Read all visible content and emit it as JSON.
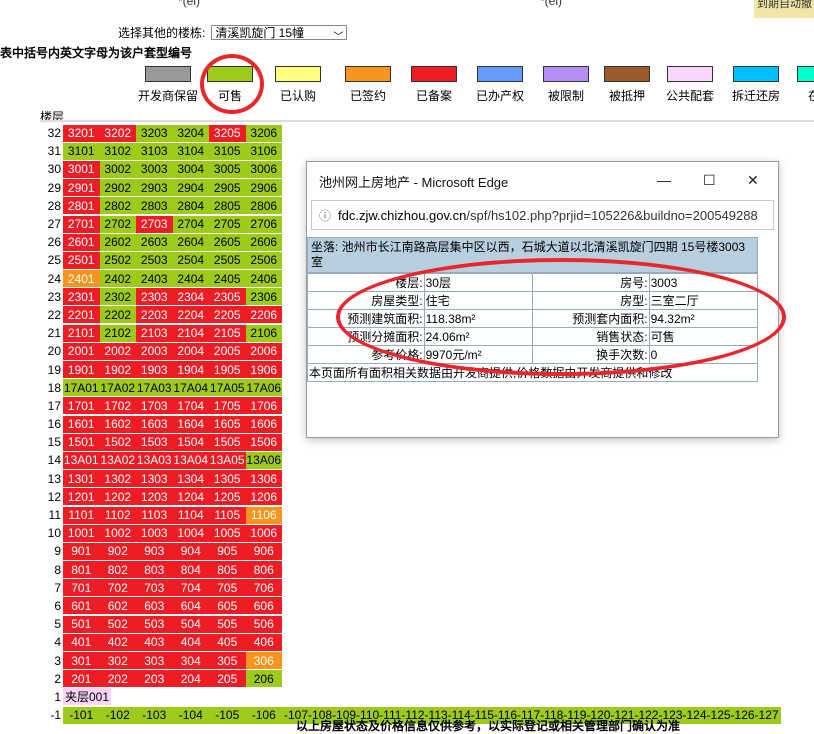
{
  "top": {
    "frag1": "*(el)",
    "frag2": "*(el)",
    "note": "到期自动撤"
  },
  "select_row": {
    "label": "选择其他的楼栋:",
    "value": "清溪凯旋门 15幢"
  },
  "hint": "表中括号内英文字母为该户套型编号",
  "legend": [
    {
      "label": "开发商保留",
      "color": "#999999"
    },
    {
      "label": "可售",
      "color": "#9dcb1c"
    },
    {
      "label": "已认购",
      "color": "#ffff80"
    },
    {
      "label": "已签约",
      "color": "#f7941d"
    },
    {
      "label": "已备案",
      "color": "#ee1c25"
    },
    {
      "label": "已办产权",
      "color": "#6699ff"
    },
    {
      "label": "被限制",
      "color": "#b38ef5"
    },
    {
      "label": "被抵押",
      "color": "#9c5b2b"
    },
    {
      "label": "公共配套",
      "color": "#f9d4f9"
    },
    {
      "label": "拆迁还房",
      "color": "#00bfff"
    },
    {
      "label": "在办",
      "color": "#00ffcc"
    }
  ],
  "floor_header": "楼层",
  "floors": [
    {
      "n": "32",
      "units": [
        [
          "3201",
          "s"
        ],
        [
          "3202",
          "s"
        ],
        [
          "3203",
          "a"
        ],
        [
          "3204",
          "a"
        ],
        [
          "3205",
          "s"
        ],
        [
          "3206",
          "a"
        ]
      ]
    },
    {
      "n": "31",
      "units": [
        [
          "3101",
          "a"
        ],
        [
          "3102",
          "a"
        ],
        [
          "3103",
          "a"
        ],
        [
          "3104",
          "a"
        ],
        [
          "3105",
          "a"
        ],
        [
          "3106",
          "a"
        ]
      ]
    },
    {
      "n": "30",
      "units": [
        [
          "3001",
          "s"
        ],
        [
          "3002",
          "a"
        ],
        [
          "3003",
          "a"
        ],
        [
          "3004",
          "a"
        ],
        [
          "3005",
          "a"
        ],
        [
          "3006",
          "a"
        ]
      ]
    },
    {
      "n": "29",
      "units": [
        [
          "2901",
          "s"
        ],
        [
          "2902",
          "a"
        ],
        [
          "2903",
          "a"
        ],
        [
          "2904",
          "a"
        ],
        [
          "2905",
          "a"
        ],
        [
          "2906",
          "a"
        ]
      ]
    },
    {
      "n": "28",
      "units": [
        [
          "2801",
          "s"
        ],
        [
          "2802",
          "a"
        ],
        [
          "2803",
          "a"
        ],
        [
          "2804",
          "a"
        ],
        [
          "2805",
          "a"
        ],
        [
          "2806",
          "a"
        ]
      ]
    },
    {
      "n": "27",
      "units": [
        [
          "2701",
          "s"
        ],
        [
          "2702",
          "a"
        ],
        [
          "2703",
          "s"
        ],
        [
          "2704",
          "a"
        ],
        [
          "2705",
          "a"
        ],
        [
          "2706",
          "a"
        ]
      ]
    },
    {
      "n": "26",
      "units": [
        [
          "2601",
          "s"
        ],
        [
          "2602",
          "a"
        ],
        [
          "2603",
          "a"
        ],
        [
          "2604",
          "a"
        ],
        [
          "2605",
          "a"
        ],
        [
          "2606",
          "a"
        ]
      ]
    },
    {
      "n": "25",
      "units": [
        [
          "2501",
          "s"
        ],
        [
          "2502",
          "a"
        ],
        [
          "2503",
          "a"
        ],
        [
          "2504",
          "a"
        ],
        [
          "2505",
          "a"
        ],
        [
          "2506",
          "a"
        ]
      ]
    },
    {
      "n": "24",
      "units": [
        [
          "2401",
          "o"
        ],
        [
          "2402",
          "a"
        ],
        [
          "2403",
          "a"
        ],
        [
          "2404",
          "a"
        ],
        [
          "2405",
          "a"
        ],
        [
          "2406",
          "a"
        ]
      ]
    },
    {
      "n": "23",
      "units": [
        [
          "2301",
          "s"
        ],
        [
          "2302",
          "a"
        ],
        [
          "2303",
          "s"
        ],
        [
          "2304",
          "s"
        ],
        [
          "2305",
          "s"
        ],
        [
          "2306",
          "a"
        ]
      ]
    },
    {
      "n": "22",
      "units": [
        [
          "2201",
          "s"
        ],
        [
          "2202",
          "a"
        ],
        [
          "2203",
          "s"
        ],
        [
          "2204",
          "s"
        ],
        [
          "2205",
          "s"
        ],
        [
          "2206",
          "s"
        ]
      ]
    },
    {
      "n": "21",
      "units": [
        [
          "2101",
          "s"
        ],
        [
          "2102",
          "a"
        ],
        [
          "2103",
          "s"
        ],
        [
          "2104",
          "s"
        ],
        [
          "2105",
          "s"
        ],
        [
          "2106",
          "a"
        ]
      ]
    },
    {
      "n": "20",
      "units": [
        [
          "2001",
          "s"
        ],
        [
          "2002",
          "s"
        ],
        [
          "2003",
          "s"
        ],
        [
          "2004",
          "s"
        ],
        [
          "2005",
          "s"
        ],
        [
          "2006",
          "s"
        ]
      ]
    },
    {
      "n": "19",
      "units": [
        [
          "1901",
          "s"
        ],
        [
          "1902",
          "s"
        ],
        [
          "1903",
          "s"
        ],
        [
          "1904",
          "s"
        ],
        [
          "1905",
          "s"
        ],
        [
          "1906",
          "s"
        ]
      ]
    },
    {
      "n": "18",
      "units": [
        [
          "17A01",
          "a"
        ],
        [
          "17A02",
          "a"
        ],
        [
          "17A03",
          "a"
        ],
        [
          "17A04",
          "a"
        ],
        [
          "17A05",
          "a"
        ],
        [
          "17A06",
          "a"
        ]
      ]
    },
    {
      "n": "17",
      "units": [
        [
          "1701",
          "s"
        ],
        [
          "1702",
          "s"
        ],
        [
          "1703",
          "s"
        ],
        [
          "1704",
          "s"
        ],
        [
          "1705",
          "s"
        ],
        [
          "1706",
          "s"
        ]
      ]
    },
    {
      "n": "16",
      "units": [
        [
          "1601",
          "s"
        ],
        [
          "1602",
          "s"
        ],
        [
          "1603",
          "s"
        ],
        [
          "1604",
          "s"
        ],
        [
          "1605",
          "s"
        ],
        [
          "1606",
          "s"
        ]
      ]
    },
    {
      "n": "15",
      "units": [
        [
          "1501",
          "s"
        ],
        [
          "1502",
          "s"
        ],
        [
          "1503",
          "s"
        ],
        [
          "1504",
          "s"
        ],
        [
          "1505",
          "s"
        ],
        [
          "1506",
          "s"
        ]
      ]
    },
    {
      "n": "14",
      "units": [
        [
          "13A01",
          "s"
        ],
        [
          "13A02",
          "s"
        ],
        [
          "13A03",
          "s"
        ],
        [
          "13A04",
          "s"
        ],
        [
          "13A05",
          "s"
        ],
        [
          "13A06",
          "a"
        ]
      ]
    },
    {
      "n": "13",
      "units": [
        [
          "1301",
          "s"
        ],
        [
          "1302",
          "s"
        ],
        [
          "1303",
          "s"
        ],
        [
          "1304",
          "s"
        ],
        [
          "1305",
          "s"
        ],
        [
          "1306",
          "s"
        ]
      ]
    },
    {
      "n": "12",
      "units": [
        [
          "1201",
          "s"
        ],
        [
          "1202",
          "s"
        ],
        [
          "1203",
          "s"
        ],
        [
          "1204",
          "s"
        ],
        [
          "1205",
          "s"
        ],
        [
          "1206",
          "s"
        ]
      ]
    },
    {
      "n": "11",
      "units": [
        [
          "1101",
          "s"
        ],
        [
          "1102",
          "s"
        ],
        [
          "1103",
          "s"
        ],
        [
          "1104",
          "s"
        ],
        [
          "1105",
          "s"
        ],
        [
          "1106",
          "o"
        ]
      ]
    },
    {
      "n": "10",
      "units": [
        [
          "1001",
          "s"
        ],
        [
          "1002",
          "s"
        ],
        [
          "1003",
          "s"
        ],
        [
          "1004",
          "s"
        ],
        [
          "1005",
          "s"
        ],
        [
          "1006",
          "s"
        ]
      ]
    },
    {
      "n": "9",
      "units": [
        [
          "901",
          "s"
        ],
        [
          "902",
          "s"
        ],
        [
          "903",
          "s"
        ],
        [
          "904",
          "s"
        ],
        [
          "905",
          "s"
        ],
        [
          "906",
          "s"
        ]
      ]
    },
    {
      "n": "8",
      "units": [
        [
          "801",
          "s"
        ],
        [
          "802",
          "s"
        ],
        [
          "803",
          "s"
        ],
        [
          "804",
          "s"
        ],
        [
          "805",
          "s"
        ],
        [
          "806",
          "s"
        ]
      ]
    },
    {
      "n": "7",
      "units": [
        [
          "701",
          "s"
        ],
        [
          "702",
          "s"
        ],
        [
          "703",
          "s"
        ],
        [
          "704",
          "s"
        ],
        [
          "705",
          "s"
        ],
        [
          "706",
          "s"
        ]
      ]
    },
    {
      "n": "6",
      "units": [
        [
          "601",
          "s"
        ],
        [
          "602",
          "s"
        ],
        [
          "603",
          "s"
        ],
        [
          "604",
          "s"
        ],
        [
          "605",
          "s"
        ],
        [
          "606",
          "s"
        ]
      ]
    },
    {
      "n": "5",
      "units": [
        [
          "501",
          "s"
        ],
        [
          "502",
          "s"
        ],
        [
          "503",
          "s"
        ],
        [
          "504",
          "s"
        ],
        [
          "505",
          "s"
        ],
        [
          "506",
          "s"
        ]
      ]
    },
    {
      "n": "4",
      "units": [
        [
          "401",
          "s"
        ],
        [
          "402",
          "s"
        ],
        [
          "403",
          "s"
        ],
        [
          "404",
          "s"
        ],
        [
          "405",
          "s"
        ],
        [
          "406",
          "s"
        ]
      ]
    },
    {
      "n": "3",
      "units": [
        [
          "301",
          "s"
        ],
        [
          "302",
          "s"
        ],
        [
          "303",
          "s"
        ],
        [
          "304",
          "s"
        ],
        [
          "305",
          "s"
        ],
        [
          "306",
          "o"
        ]
      ]
    },
    {
      "n": "2",
      "units": [
        [
          "201",
          "s"
        ],
        [
          "202",
          "s"
        ],
        [
          "203",
          "s"
        ],
        [
          "204",
          "s"
        ],
        [
          "205",
          "s"
        ],
        [
          "206",
          "a"
        ]
      ]
    },
    {
      "n": "1",
      "units": [
        [
          "夹层001",
          "p"
        ]
      ]
    },
    {
      "n": "-1",
      "units": [
        [
          "-101",
          "a"
        ],
        [
          "-102",
          "a"
        ],
        [
          "-103",
          "a"
        ],
        [
          "-104",
          "a"
        ],
        [
          "-105",
          "a"
        ],
        [
          "-106",
          "a"
        ],
        [
          "-107-108-109-110-111-112-113-114-115-116-117-118-119-120-121-122-123-124-125-126-127",
          "a"
        ]
      ]
    }
  ],
  "bottom_note": "以上房屋状态及价格信息仅供参考，以实际登记或相关管理部门确认为准",
  "popup": {
    "title": "池州网上房地产 - Microsoft Edge",
    "min": "—",
    "max": "☐",
    "close": "✕",
    "url_domain": "fdc.zjw.chizhou.gov.cn",
    "url_path": "/spf/hs102.php?prjid=105226&buildno=200549288",
    "address": "坐落:   池州市长江南路高层集中区以西，石城大道以北清溪凯旋门四期 15号楼3003室",
    "rows": [
      {
        "k1": "楼层:",
        "v1": "30层",
        "k2": "房号:",
        "v2": "3003"
      },
      {
        "k1": "房屋类型:",
        "v1": "住宅",
        "k2": "房型:",
        "v2": "三室二厅"
      },
      {
        "k1": "预测建筑面积:",
        "v1": "118.38m²",
        "k2": "预测套内面积:",
        "v2": "94.32m²"
      },
      {
        "k1": "预测分摊面积:",
        "v1": "24.06m²",
        "k2": "销售状态:",
        "v2": "可售"
      },
      {
        "k1": "参考价格:",
        "v1": "9970元/m²",
        "k2": "换手次数:",
        "v2": "0"
      }
    ],
    "footer": "本页面所有面积相关数据由开发商提供;价格数据由开发商提供和修改"
  }
}
